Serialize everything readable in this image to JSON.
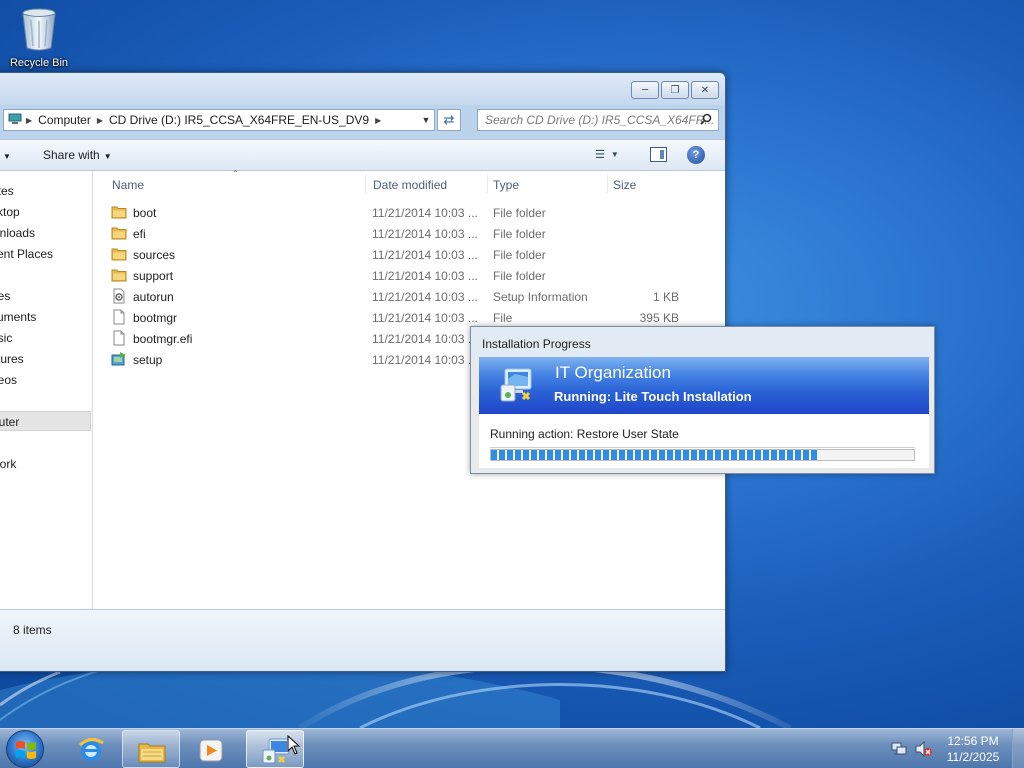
{
  "desktop": {
    "recycle_bin_label": "Recycle Bin"
  },
  "explorer": {
    "address": {
      "segments": [
        "Computer",
        "CD Drive (D:) IR5_CCSA_X64FRE_EN-US_DV9"
      ],
      "search_placeholder": "Search CD Drive (D:) IR5_CCSA_X64FR..."
    },
    "toolbar": {
      "share_with_label": "Share with"
    },
    "nav_pane": {
      "items": [
        "rites",
        "sktop",
        "wnloads",
        "cent Places",
        "ries",
        "cuments",
        "usic",
        "ctures",
        "deos",
        "puter",
        "work"
      ]
    },
    "columns": {
      "name": "Name",
      "date_modified": "Date modified",
      "type": "Type",
      "size": "Size"
    },
    "files": [
      {
        "name": "boot",
        "date": "11/21/2014 10:03 ...",
        "type": "File folder",
        "size": "",
        "icon": "folder-icon"
      },
      {
        "name": "efi",
        "date": "11/21/2014 10:03 ...",
        "type": "File folder",
        "size": "",
        "icon": "folder-icon"
      },
      {
        "name": "sources",
        "date": "11/21/2014 10:03 ...",
        "type": "File folder",
        "size": "",
        "icon": "folder-icon"
      },
      {
        "name": "support",
        "date": "11/21/2014 10:03 ...",
        "type": "File folder",
        "size": "",
        "icon": "folder-icon"
      },
      {
        "name": "autorun",
        "date": "11/21/2014 10:03 ...",
        "type": "Setup Information",
        "size": "1 KB",
        "icon": "setup-info-icon"
      },
      {
        "name": "bootmgr",
        "date": "11/21/2014 10:03 ...",
        "type": "File",
        "size": "395 KB",
        "icon": "file-icon"
      },
      {
        "name": "bootmgr.efi",
        "date": "11/21/2014 10:03 ...",
        "type": "",
        "size": "",
        "icon": "file-icon"
      },
      {
        "name": "setup",
        "date": "11/21/2014 10:03 ...",
        "type": "",
        "size": "",
        "icon": "setup-icon"
      }
    ],
    "status": {
      "item_count": "8 items"
    }
  },
  "installation_progress": {
    "title": "Installation Progress",
    "organization": "IT Organization",
    "running": "Running: Lite Touch Installation",
    "action": "Running action: Restore User State",
    "progress_fraction": 0.77
  },
  "taskbar": {
    "time": "12:56 PM",
    "date": "11/2/2025"
  },
  "colors": {
    "progress_fill": "#2f8de6",
    "banner_blue": "#2b63d6",
    "desktop_blue": "#1a5cb8"
  }
}
